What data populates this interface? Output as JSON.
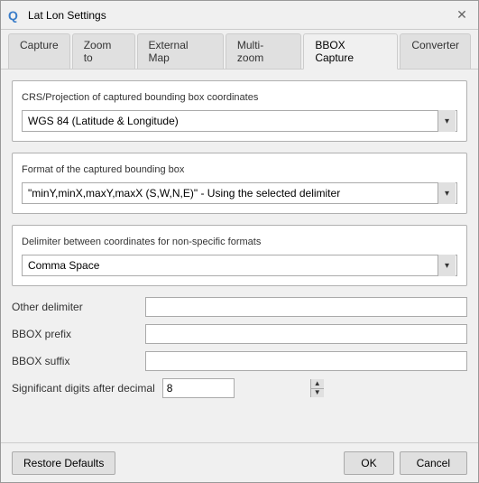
{
  "window": {
    "title": "Lat Lon Settings",
    "close_label": "✕"
  },
  "tabs": [
    {
      "id": "capture",
      "label": "Capture",
      "active": false
    },
    {
      "id": "zoom-to",
      "label": "Zoom to",
      "active": false
    },
    {
      "id": "external-map",
      "label": "External Map",
      "active": false
    },
    {
      "id": "multi-zoom",
      "label": "Multi-zoom",
      "active": false
    },
    {
      "id": "bbox-capture",
      "label": "BBOX Capture",
      "active": true
    },
    {
      "id": "converter",
      "label": "Converter",
      "active": false
    }
  ],
  "sections": {
    "crs_label": "CRS/Projection of captured bounding box coordinates",
    "crs_value": "WGS 84 (Latitude & Longitude)",
    "format_label": "Format of the captured bounding box",
    "format_value": "\"minY,minX,maxY,maxX (S,W,N,E)\" - Using the selected delimiter",
    "delimiter_label": "Delimiter between coordinates for non-specific formats",
    "delimiter_value": "Comma Space",
    "other_delimiter_label": "Other delimiter",
    "other_delimiter_value": "",
    "bbox_prefix_label": "BBOX prefix",
    "bbox_prefix_value": "",
    "bbox_suffix_label": "BBOX suffix",
    "bbox_suffix_value": "",
    "sig_digits_label": "Significant digits after decimal",
    "sig_digits_value": "8"
  },
  "footer": {
    "restore_label": "Restore Defaults",
    "ok_label": "OK",
    "cancel_label": "Cancel"
  },
  "icons": {
    "qgis": "Q",
    "chevron_down": "▾",
    "spin_up": "▲",
    "spin_down": "▼"
  }
}
